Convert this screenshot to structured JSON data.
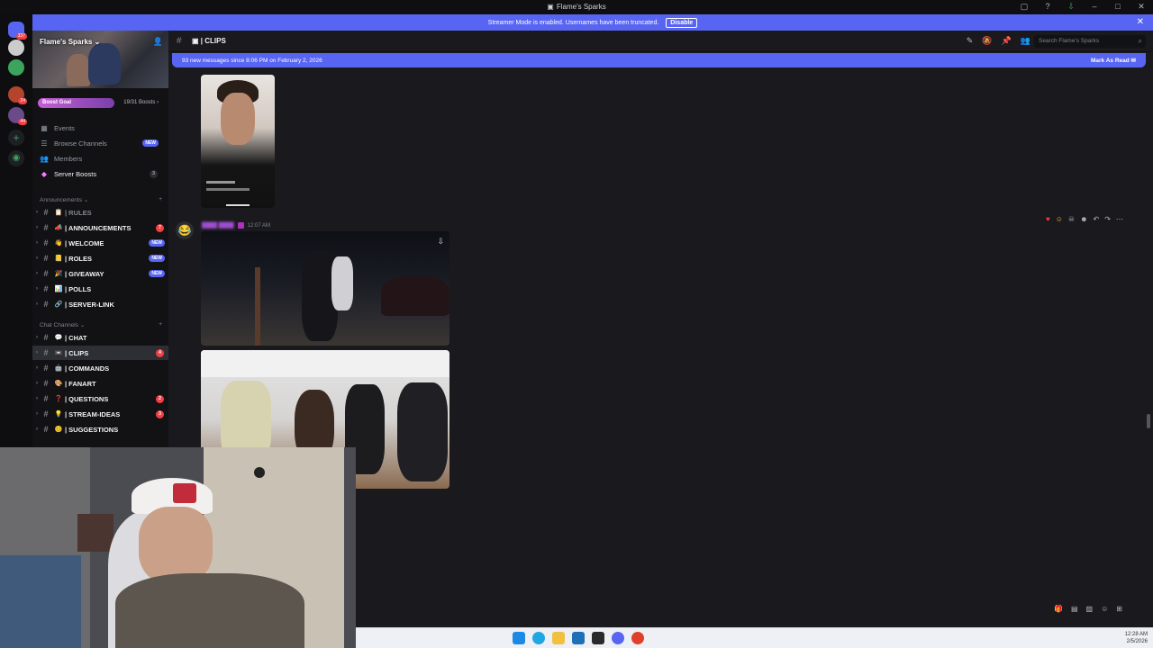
{
  "window": {
    "title": "Flame's Sparks"
  },
  "banner": {
    "text": "Streamer Mode is enabled. Usernames have been truncated.",
    "disable_label": "Disable",
    "close": "✕"
  },
  "guilds": {
    "badges": [
      "337",
      "24",
      "44"
    ]
  },
  "server": {
    "name": "Flame's Sparks ⌄",
    "boost_goal": "Boost Goal",
    "boost_count": "19/31 Boosts ›",
    "boost_progress": 0.61
  },
  "nav": {
    "events": "Events",
    "browse": "Browse Channels",
    "browse_badge": "NEW",
    "members": "Members",
    "boosts": "Server Boosts",
    "boosts_count": "3"
  },
  "categories": {
    "announcements": "Announcements ⌄",
    "chat": "Chat Channels ⌄",
    "add": "+"
  },
  "channels_ann": [
    {
      "emoji": "📋",
      "name": "| RULES",
      "badge": "",
      "muted": true
    },
    {
      "emoji": "📣",
      "name": "| ANNOUNCEMENTS",
      "badge": "7"
    },
    {
      "emoji": "👋",
      "name": "| WELCOME",
      "badge": "NEW"
    },
    {
      "emoji": "📒",
      "name": "| ROLES",
      "badge": "NEW"
    },
    {
      "emoji": "🎉",
      "name": "| GIVEAWAY",
      "badge": "NEW"
    },
    {
      "emoji": "📊",
      "name": "| POLLS",
      "badge": ""
    },
    {
      "emoji": "🔗",
      "name": "| SERVER-LINK",
      "badge": ""
    }
  ],
  "channels_chat": [
    {
      "emoji": "💬",
      "name": "| CHAT",
      "badge": ""
    },
    {
      "emoji": "📼",
      "name": "| CLIPS",
      "badge": "4",
      "selected": true
    },
    {
      "emoji": "🤖",
      "name": "| COMMANDS",
      "badge": ""
    },
    {
      "emoji": "🎨",
      "name": "| FANART",
      "badge": ""
    },
    {
      "emoji": "❓",
      "name": "| QUESTIONS",
      "badge": "2"
    },
    {
      "emoji": "💡",
      "name": "| STREAM-IDEAS",
      "badge": "3"
    },
    {
      "emoji": "😊",
      "name": "| SUGGESTIONS",
      "badge": ""
    }
  ],
  "channel_header": {
    "hash": "#",
    "name": "| CLIPS",
    "search_placeholder": "Search Flame's Sparks"
  },
  "new_messages": {
    "text": "93 new messages since 8:06 PM on February 2, 2026",
    "mark_read": "Mark As Read"
  },
  "message": {
    "username": "████ ████",
    "time": "12:07 AM"
  },
  "taskbar": {
    "time": "12:28 AM",
    "date": "2/5/2026"
  },
  "colors": {
    "blurple": "#5865f2",
    "bg": "#1a1a1e",
    "sidebar": "#121214",
    "red": "#f23f43"
  }
}
